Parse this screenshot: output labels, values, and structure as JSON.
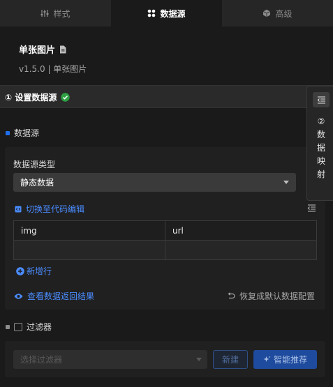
{
  "tabs": [
    {
      "label": "样式",
      "icon": "sliders-icon",
      "active": false
    },
    {
      "label": "数据源",
      "icon": "grid-dots-icon",
      "active": true
    },
    {
      "label": "高级",
      "icon": "cube-icon",
      "active": false
    }
  ],
  "component": {
    "title": "单张图片",
    "version_line": "v1.5.0 | 单张图片"
  },
  "step": {
    "title": "① 设置数据源",
    "status_color": "#2ea043"
  },
  "side_panel": {
    "text": "② 数 据 映 射"
  },
  "datasource": {
    "section_label": "数据源",
    "type_label": "数据源类型",
    "type_value": "静态数据",
    "code_toggle": "切换至代码编辑",
    "columns": [
      "img",
      "url"
    ],
    "rows": [
      [
        "",
        ""
      ]
    ],
    "add_row": "新增行",
    "view_result": "查看数据返回结果",
    "reset_default": "恢复成默认数据配置"
  },
  "filter": {
    "section_label": "过滤器",
    "placeholder": "选择过滤器",
    "new_button": "新建",
    "smart_button": "智能推荐"
  },
  "colors": {
    "accent": "#4a8cff",
    "bg": "#1a1a1a",
    "panel": "#202020"
  }
}
